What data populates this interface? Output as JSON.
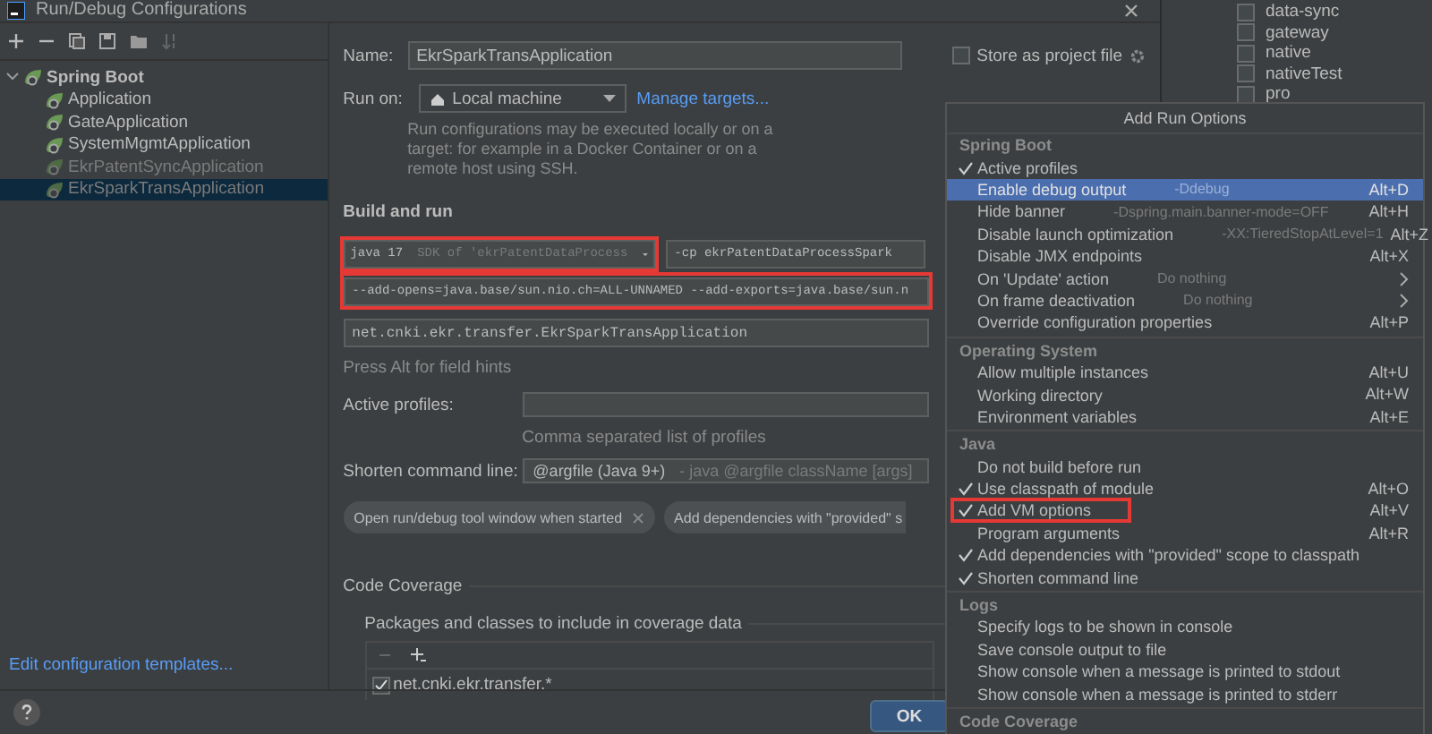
{
  "window": {
    "title": "Run/Debug Configurations"
  },
  "tree": {
    "label": "Spring Boot",
    "expanded": true,
    "children": [
      {
        "label": "Application",
        "selected": false,
        "disabled": false
      },
      {
        "label": "GateApplication",
        "selected": false,
        "disabled": false
      },
      {
        "label": "SystemMgmtApplication",
        "selected": false,
        "disabled": false
      },
      {
        "label": "EkrPatentSyncApplication",
        "selected": false,
        "disabled": true
      },
      {
        "label": "EkrSparkTransApplication",
        "selected": true,
        "disabled": true
      }
    ]
  },
  "templates_link": "Edit configuration templates...",
  "form": {
    "name": {
      "label": "Name:",
      "value": "EkrSparkTransApplication"
    },
    "store_as_project_file": {
      "label": "Store as project file",
      "checked": false
    },
    "run_on": {
      "label": "Run on:",
      "value": "Local machine",
      "link": "Manage targets..."
    },
    "run_on_description": "Run configurations may be executed locally or on a target: for example in a Docker Container or on a remote host using SSH.",
    "section_title": "Build and run",
    "jre": {
      "value": "java 17",
      "hint": "SDK of 'ekrPatentDataProcess",
      "highlighted": true
    },
    "classpath": {
      "value": "-cp ekrPatentDataProcessSpark",
      "highlighted": false
    },
    "vm_options": {
      "value": "--add-opens=java.base/sun.nio.ch=ALL-UNNAMED --add-exports=java.base/sun.n",
      "highlighted": true
    },
    "main_class": {
      "value": "net.cnki.ekr.transfer.EkrSparkTransApplication",
      "highlighted": false
    },
    "field_hint": "Press Alt for field hints",
    "active_profiles": {
      "label": "Active profiles:",
      "help": "Comma separated list of profiles"
    },
    "shorten_command_line": {
      "label": "Shorten command line:",
      "value": "@argfile (Java 9+)",
      "hint": "- java @argfile className [args]"
    },
    "chips": [
      {
        "label": "Open run/debug tool window when started",
        "closable": true
      },
      {
        "label": "Add dependencies with \"provided\" s",
        "closable": false
      }
    ],
    "code_coverage": {
      "title": "Code Coverage",
      "subtitle": "Packages and classes to include in coverage data",
      "entries": [
        {
          "label": "net.cnki.ekr.transfer.*",
          "checked": true
        }
      ]
    }
  },
  "ok_button": "OK",
  "background_window": {
    "items": [
      {
        "label": "data-sync",
        "checked": false
      },
      {
        "label": "gateway",
        "checked": false
      },
      {
        "label": "native",
        "checked": false
      },
      {
        "label": "nativeTest",
        "checked": false
      },
      {
        "label": "pro",
        "checked": false
      }
    ]
  },
  "popup": {
    "title": "Add Run Options",
    "sections": [
      {
        "title": "Spring Boot",
        "items": [
          {
            "label": "Active profiles",
            "checked": true,
            "selected": false,
            "submenu": false,
            "highlighted": false
          },
          {
            "label": "Enable debug output",
            "hint": "-Ddebug",
            "shortcut": "Alt+D",
            "checked": false,
            "selected": true,
            "submenu": false,
            "highlighted": false
          },
          {
            "label": "Hide banner",
            "hint": "-Dspring.main.banner-mode=OFF",
            "shortcut": "Alt+H",
            "checked": false,
            "selected": false,
            "submenu": false,
            "highlighted": false
          },
          {
            "label": "Disable launch optimization",
            "hint": "-XX:TieredStopAtLevel=1",
            "shortcut": "Alt+Z",
            "checked": false,
            "selected": false,
            "submenu": false,
            "highlighted": false
          },
          {
            "label": "Disable JMX endpoints",
            "shortcut": "Alt+X",
            "checked": false,
            "selected": false,
            "submenu": false,
            "highlighted": false
          },
          {
            "label": "On 'Update' action",
            "hint": "Do nothing",
            "checked": false,
            "selected": false,
            "submenu": true,
            "highlighted": false
          },
          {
            "label": "On frame deactivation",
            "hint": "Do nothing",
            "checked": false,
            "selected": false,
            "submenu": true,
            "highlighted": false
          },
          {
            "label": "Override configuration properties",
            "shortcut": "Alt+P",
            "checked": false,
            "selected": false,
            "submenu": false,
            "highlighted": false
          }
        ]
      },
      {
        "title": "Operating System",
        "items": [
          {
            "label": "Allow multiple instances",
            "shortcut": "Alt+U",
            "checked": false,
            "selected": false,
            "submenu": false,
            "highlighted": false
          },
          {
            "label": "Working directory",
            "shortcut": "Alt+W",
            "checked": false,
            "selected": false,
            "submenu": false,
            "highlighted": false
          },
          {
            "label": "Environment variables",
            "shortcut": "Alt+E",
            "checked": false,
            "selected": false,
            "submenu": false,
            "highlighted": false
          }
        ]
      },
      {
        "title": "Java",
        "items": [
          {
            "label": "Do not build before run",
            "checked": false,
            "selected": false,
            "submenu": false,
            "highlighted": false
          },
          {
            "label": "Use classpath of module",
            "shortcut": "Alt+O",
            "checked": true,
            "selected": false,
            "submenu": false,
            "highlighted": false
          },
          {
            "label": "Add VM options",
            "shortcut": "Alt+V",
            "checked": true,
            "selected": false,
            "submenu": false,
            "highlighted": true
          },
          {
            "label": "Program arguments",
            "shortcut": "Alt+R",
            "checked": false,
            "selected": false,
            "submenu": false,
            "highlighted": false
          },
          {
            "label": "Add dependencies with \"provided\" scope to classpath",
            "checked": true,
            "selected": false,
            "submenu": false,
            "highlighted": false
          },
          {
            "label": "Shorten command line",
            "checked": true,
            "selected": false,
            "submenu": false,
            "highlighted": false
          }
        ]
      },
      {
        "title": "Logs",
        "items": [
          {
            "label": "Specify logs to be shown in console",
            "checked": false,
            "selected": false,
            "submenu": false,
            "highlighted": false
          },
          {
            "label": "Save console output to file",
            "checked": false,
            "selected": false,
            "submenu": false,
            "highlighted": false
          },
          {
            "label": "Show console when a message is printed to stdout",
            "checked": false,
            "selected": false,
            "submenu": false,
            "highlighted": false
          },
          {
            "label": "Show console when a message is printed to stderr",
            "checked": false,
            "selected": false,
            "submenu": false,
            "highlighted": false
          }
        ]
      },
      {
        "title": "Code Coverage"
      }
    ]
  }
}
